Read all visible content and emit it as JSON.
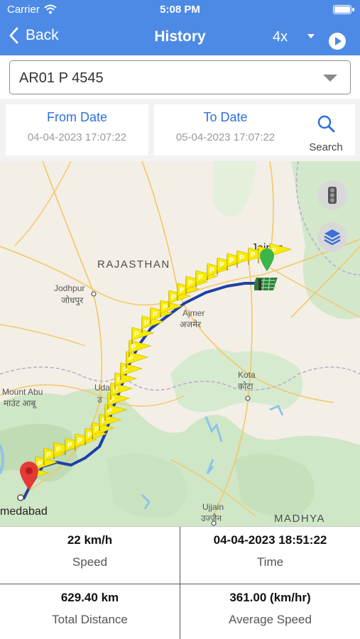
{
  "status_bar": {
    "carrier": "Carrier",
    "time": "5:08 PM"
  },
  "nav": {
    "back_label": "Back",
    "title": "History",
    "playback_speed": "4x"
  },
  "vehicle_select": {
    "value": "AR01 P 4545"
  },
  "from_date": {
    "label": "From Date",
    "value": "04-04-2023 17:07:22"
  },
  "to_date": {
    "label": "To Date",
    "value": "05-04-2023 17:07:22"
  },
  "search": {
    "label": "Search"
  },
  "map": {
    "labels": {
      "rajasthan": "RAJASTHAN",
      "jaipur": "Jaipur",
      "jodhpur": "Jodhpur",
      "jodhpur_hi": "जोधपुर",
      "ajmer": "Ajmer",
      "ajmer_hi": "अजमेर",
      "kota": "Kota",
      "kota_hi": "कोटा",
      "mount_abu": "Mount Abu",
      "mount_abu_hi": "माउंट आबू",
      "udaipur": "Uda",
      "udaipur_hi": "उ",
      "ujjain": "Ujjain",
      "ujjain_hi": "उज्जैन",
      "madhya": "MADHYA",
      "ahmedabad": "medabad"
    },
    "marker_glyph": "P",
    "colors": {
      "route": "#1f3fa8",
      "flag": "#f9ec00",
      "start_pin": "#e53935",
      "end_pin": "#3bb54a",
      "header": "#4d8ae6"
    }
  },
  "stats": {
    "speed": {
      "value": "22 km/h",
      "label": "Speed"
    },
    "time": {
      "value": "04-04-2023 18:51:22",
      "label": "Time"
    },
    "total_distance": {
      "value": "629.40 km",
      "label": "Total Distance"
    },
    "average_speed": {
      "value": "361.00 (km/hr)",
      "label": "Average Speed"
    }
  }
}
